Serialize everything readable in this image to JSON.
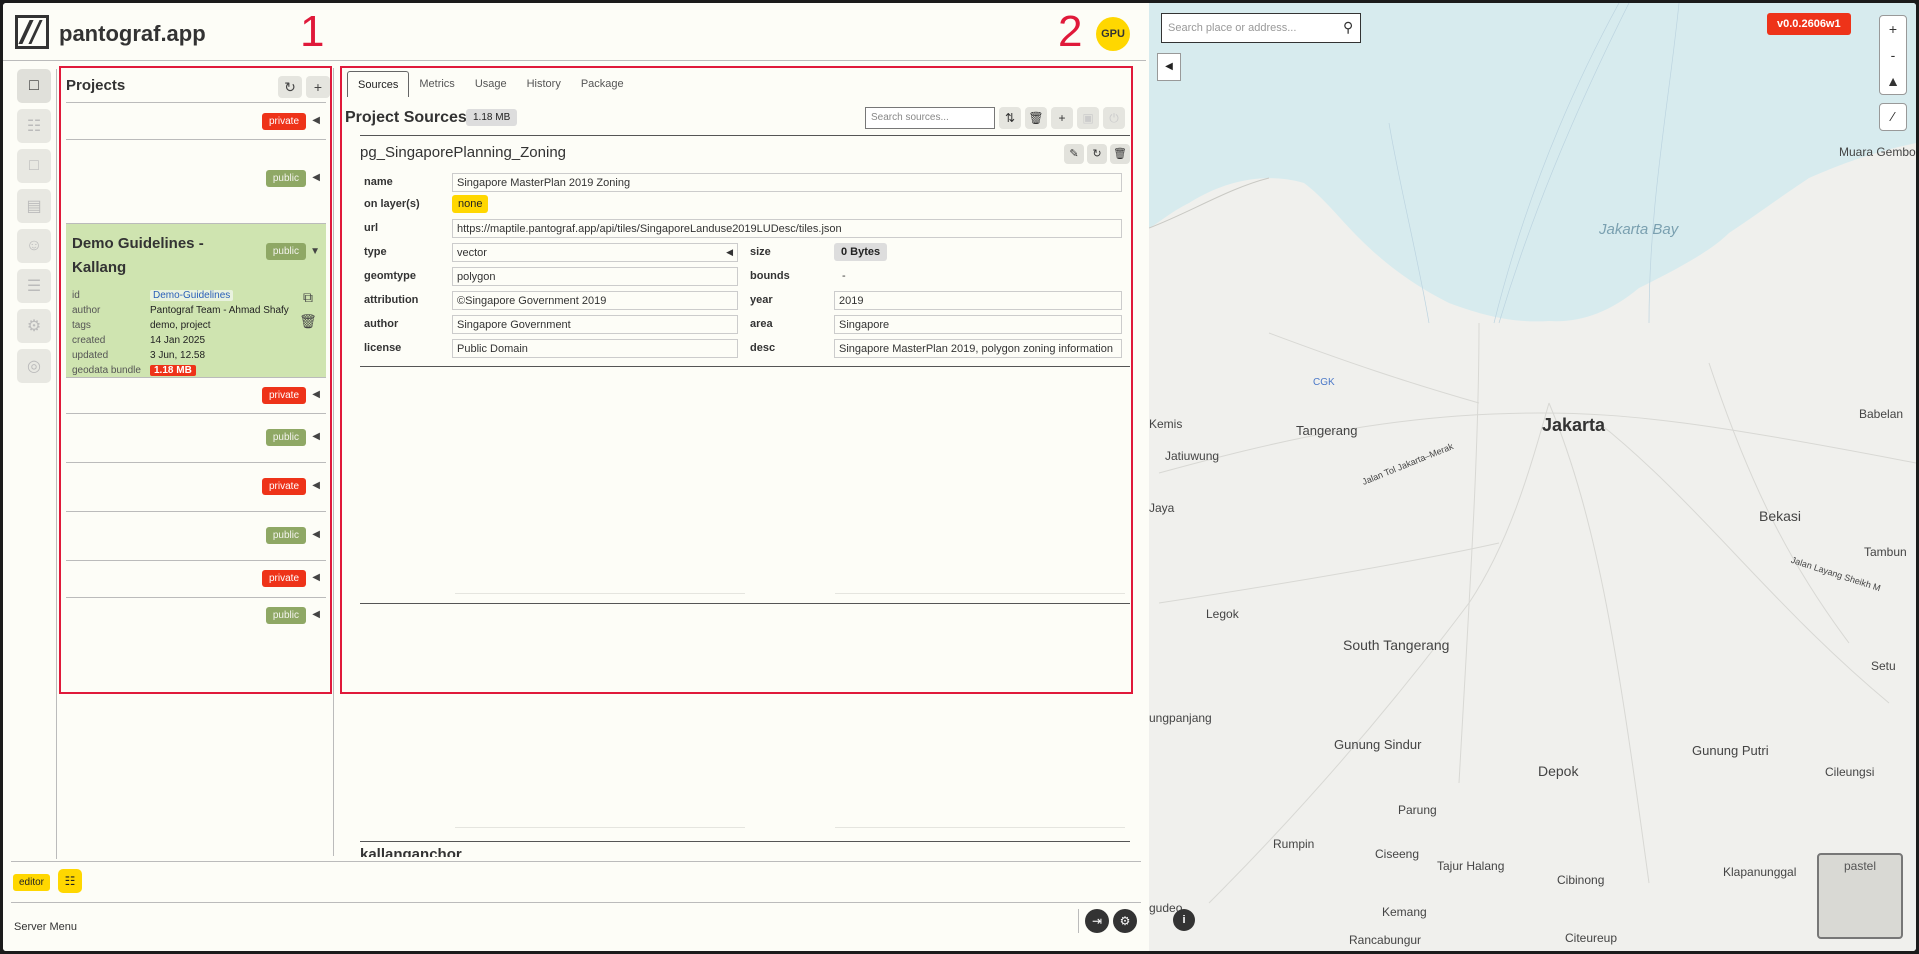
{
  "app": {
    "title": "pantograf.app",
    "gpu_label": "GPU"
  },
  "annotations": {
    "one": "1",
    "two": "2"
  },
  "projects": {
    "title": "Projects",
    "list": [
      {
        "visibility": "private"
      },
      {
        "visibility": "public"
      },
      {
        "visibility": "public",
        "selected": true
      },
      {
        "visibility": "private"
      },
      {
        "visibility": "public"
      },
      {
        "visibility": "private"
      },
      {
        "visibility": "public"
      },
      {
        "visibility": "private"
      },
      {
        "visibility": "public"
      }
    ],
    "selected": {
      "name": "Demo Guidelines - Kallang",
      "visibility": "public",
      "meta": {
        "id_label": "id",
        "id": "Demo-Guidelines",
        "author_label": "author",
        "author": "Pantograf Team - Ahmad Shafy",
        "tags_label": "tags",
        "tags": "demo, project",
        "created_label": "created",
        "created": "14 Jan 2025",
        "updated_label": "updated",
        "updated": "3 Jun, 12.58",
        "bundle_label": "geodata bundle",
        "bundle": "1.18 MB"
      }
    }
  },
  "tabs": {
    "sources": "Sources",
    "metrics": "Metrics",
    "usage": "Usage",
    "history": "History",
    "package": "Package"
  },
  "sources": {
    "title": "Project Sources",
    "size": "1.18 MB",
    "search_placeholder": "Search sources...",
    "source1": {
      "name": "pg_SingaporePlanning_Zoning",
      "labels": {
        "name": "name",
        "layers": "on layer(s)",
        "url": "url",
        "type": "type",
        "size": "size",
        "geomtype": "geomtype",
        "bounds": "bounds",
        "attribution": "attribution",
        "year": "year",
        "author": "author",
        "area": "area",
        "license": "license",
        "desc": "desc"
      },
      "values": {
        "name": "Singapore MasterPlan 2019 Zoning",
        "layers": "none",
        "url": "https://maptile.pantograf.app/api/tiles/SingaporeLanduse2019LUDesc/tiles.json",
        "type": "vector",
        "size": "0 Bytes",
        "geomtype": "polygon",
        "bounds": "-",
        "attribution": "©Singapore Government 2019",
        "year": "2019",
        "author": "Singapore Government",
        "area": "Singapore",
        "license": "Public Domain",
        "desc": "Singapore MasterPlan 2019, polygon zoning information"
      }
    },
    "source2": {
      "name": "kallanganchor"
    }
  },
  "footer": {
    "editor": "editor",
    "server_menu": "Server Menu"
  },
  "map": {
    "search_placeholder": "Search place or address...",
    "version": "v0.0.2606w1",
    "zoom_in": "+",
    "zoom_out": "-",
    "basemap": "pastel",
    "info": "i",
    "labels": {
      "jakarta_bay": "Jakarta Bay",
      "muara": "Muara Gembong",
      "jakarta": "Jakarta",
      "tangerang": "Tangerang",
      "kemis": "Kemis",
      "jatiuwung": "Jatiuwung",
      "jaya": "Jaya",
      "bekasi": "Bekasi",
      "babelan": "Babelan",
      "tambun": "Tambun",
      "legok": "Legok",
      "south_tangerang": "South Tangerang",
      "setu": "Setu",
      "gupanjang": "ungpanjang",
      "gunung_sindur": "Gunung Sindur",
      "gunung_putri": "Gunung Putri",
      "depok": "Depok",
      "cileungsi": "Cileungsi",
      "parung": "Parung",
      "rumpin": "Rumpin",
      "ciseeng": "Ciseeng",
      "tajur": "Tajur Halang",
      "cibinong": "Cibinong",
      "klapanunggal": "Klapanunggal",
      "kemang": "Kemang",
      "gudeo": "gudeo",
      "rancabungur": "Rancabungur",
      "citeureup": "Citeureup",
      "cgk": "CGK",
      "toll": "Jalan Tol Jakarta–Merak",
      "toll2": "Jalan Layang Sheikh M"
    }
  }
}
